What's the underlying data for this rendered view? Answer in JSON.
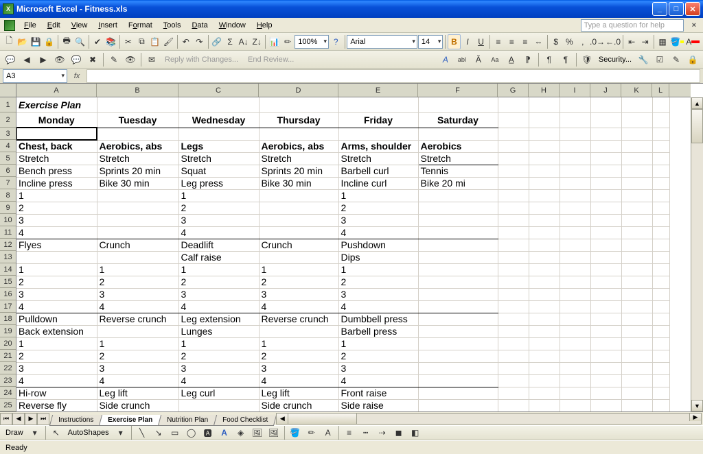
{
  "window": {
    "title": "Microsoft Excel - Fitness.xls"
  },
  "menus": [
    "File",
    "Edit",
    "View",
    "Insert",
    "Format",
    "Tools",
    "Data",
    "Window",
    "Help"
  ],
  "help_placeholder": "Type a question for help",
  "font": {
    "name": "Arial",
    "size": "14"
  },
  "zoom": "100%",
  "namebox": "A3",
  "status": "Ready",
  "sheet_tabs": [
    "Instructions",
    "Exercise Plan",
    "Nutrition Plan",
    "Food Checklist"
  ],
  "active_tab": 1,
  "toolbar_labels": {
    "reply": "Reply with Changes...",
    "end": "End Review...",
    "security": "Security...",
    "autoshapes": "AutoShapes",
    "draw": "Draw"
  },
  "col_widths": {
    "A": 117,
    "B": 119,
    "C": 117,
    "D": 116,
    "E": 116,
    "F": 116,
    "G": 45,
    "H": 45,
    "I": 45,
    "J": 45,
    "K": 45,
    "L": 25
  },
  "columns": [
    "A",
    "B",
    "C",
    "D",
    "E",
    "F",
    "G",
    "H",
    "I",
    "J",
    "K",
    "L"
  ],
  "row_heights": {
    "1": 22,
    "2": 22,
    "default": 18
  },
  "cells": {
    "A1": "Exercise Plan",
    "A2": "Monday",
    "B2": "Tuesday",
    "C2": "Wednesday",
    "D2": "Thursday",
    "E2": "Friday",
    "F2": "Saturday",
    "A4": "Chest, back",
    "B4": "Aerobics, abs",
    "C4": "Legs",
    "D4": "Aerobics, abs",
    "E4": "Arms, shoulder",
    "F4": "Aerobics",
    "A5": "Stretch",
    "B5": "Stretch",
    "C5": "Stretch",
    "D5": "Stretch",
    "E5": "Stretch",
    "F5": "Stretch",
    "A6": "Bench press",
    "B6": "Sprints 20 min",
    "C6": "Squat",
    "D6": "Sprints 20 min",
    "E6": "Barbell curl",
    "F6": "Tennis",
    "A7": "Incline press",
    "B7": "Bike 30 min",
    "C7": "Leg press",
    "D7": "Bike 30 min",
    "E7": "Incline curl",
    "F7": "Bike 20 mi",
    "A8": "1",
    "C8": "1",
    "E8": "1",
    "A9": "2",
    "C9": "2",
    "E9": "2",
    "A10": "3",
    "C10": "3",
    "E10": "3",
    "A11": "4",
    "C11": "4",
    "E11": "4",
    "A12": "Flyes",
    "B12": "Crunch",
    "C12": "Deadlift",
    "D12": "Crunch",
    "E12": "Pushdown",
    "C13": "Calf raise",
    "E13": "Dips",
    "A14": "1",
    "B14": "1",
    "C14": "1",
    "D14": "1",
    "E14": "1",
    "A15": "2",
    "B15": "2",
    "C15": "2",
    "D15": "2",
    "E15": "2",
    "A16": "3",
    "B16": "3",
    "C16": "3",
    "D16": "3",
    "E16": "3",
    "A17": "4",
    "B17": "4",
    "C17": "4",
    "D17": "4",
    "E17": "4",
    "A18": "Pulldown",
    "B18": "Reverse crunch",
    "C18": "Leg extension",
    "D18": "Reverse crunch",
    "E18": "Dumbbell press",
    "A19": "Back extension",
    "C19": "Lunges",
    "E19": "Barbell press",
    "A20": "1",
    "B20": "1",
    "C20": "1",
    "D20": "1",
    "E20": "1",
    "A21": "2",
    "B21": "2",
    "C21": "2",
    "D21": "2",
    "E21": "2",
    "A22": "3",
    "B22": "3",
    "C22": "3",
    "D22": "3",
    "E22": "3",
    "A23": "4",
    "B23": "4",
    "C23": "4",
    "D23": "4",
    "E23": "4",
    "A24": "Hi-row",
    "B24": "Leg lift",
    "C24": "Leg curl",
    "D24": "Leg lift",
    "E24": "Front raise",
    "A25": "Reverse fly",
    "B25": "Side crunch",
    "D25": "Side crunch",
    "E25": "Side raise"
  }
}
